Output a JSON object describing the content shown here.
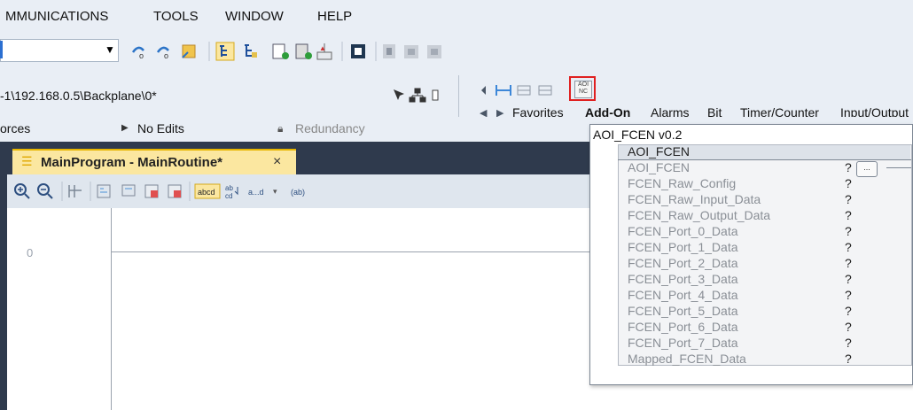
{
  "menu": [
    "MMUNICATIONS",
    "TOOLS",
    "WINDOW",
    "HELP"
  ],
  "path_text": "-1\\192.168.0.5\\Backplane\\0*",
  "status": {
    "forces": "orces",
    "edits": "No Edits",
    "redundancy": "Redundancy"
  },
  "instruction_tabs": [
    "Favorites",
    "Add-On",
    "Alarms",
    "Bit",
    "Timer/Counter",
    "Input/Output"
  ],
  "aoi_button_label": "AOI",
  "aoi_button_sublabel": "NC",
  "routine_tab": "MainProgram - MainRoutine*",
  "tab_close": "×",
  "ladder_rung_number": "0",
  "popup": {
    "title": "AOI_FCEN v0.2",
    "header": "AOI_FCEN",
    "ellipsis": "...",
    "params": [
      "AOI_FCEN",
      "FCEN_Raw_Config",
      "FCEN_Raw_Input_Data",
      "FCEN_Raw_Output_Data",
      "FCEN_Port_0_Data",
      "FCEN_Port_1_Data",
      "FCEN_Port_2_Data",
      "FCEN_Port_3_Data",
      "FCEN_Port_4_Data",
      "FCEN_Port_5_Data",
      "FCEN_Port_6_Data",
      "FCEN_Port_7_Data",
      "Mapped_FCEN_Data"
    ],
    "param_value": "?"
  },
  "ladder_toolbar_labels": {
    "abcd": "abcd",
    "ab": "ab",
    "cd": "cd",
    "ad": "a...d",
    "xab": "(ab)"
  },
  "colors": {
    "accent": "#e6b500",
    "panel": "#e9eef5",
    "dark": "#2f3a4d",
    "highlight_box": "#e02020"
  }
}
